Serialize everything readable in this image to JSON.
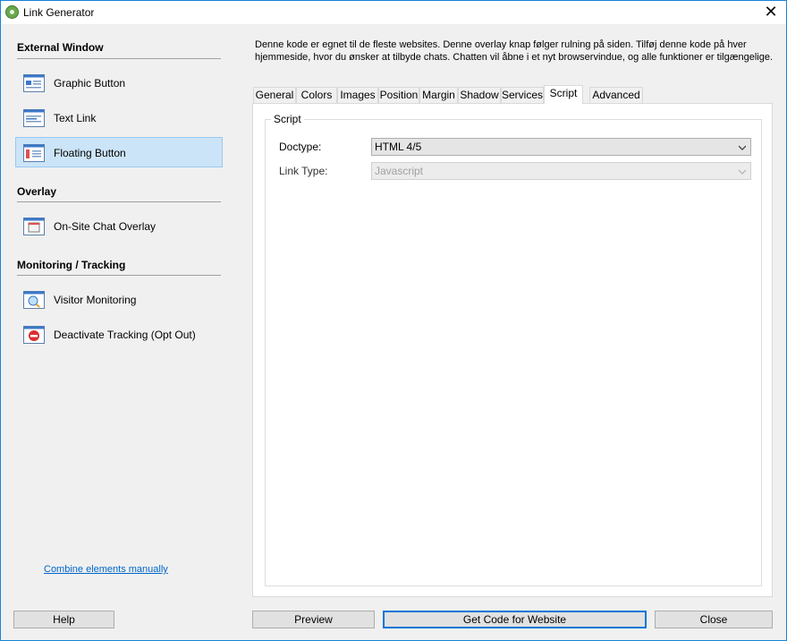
{
  "window": {
    "title": "Link Generator"
  },
  "sidebar": {
    "sections": [
      {
        "title": "External Window",
        "items": [
          {
            "label": "Graphic Button",
            "icon": "graphic-button-icon",
            "selected": false
          },
          {
            "label": "Text Link",
            "icon": "text-link-icon",
            "selected": false
          },
          {
            "label": "Floating Button",
            "icon": "floating-button-icon",
            "selected": true
          }
        ]
      },
      {
        "title": "Overlay",
        "items": [
          {
            "label": "On-Site Chat Overlay",
            "icon": "chat-overlay-icon",
            "selected": false
          }
        ]
      },
      {
        "title": "Monitoring / Tracking",
        "items": [
          {
            "label": "Visitor Monitoring",
            "icon": "visitor-monitoring-icon",
            "selected": false
          },
          {
            "label": "Deactivate Tracking (Opt Out)",
            "icon": "deactivate-tracking-icon",
            "selected": false
          }
        ]
      }
    ],
    "combine_link": "Combine elements manually"
  },
  "main": {
    "description": "Denne kode er egnet til de fleste websites. Denne overlay knap følger rulning på siden. Tilføj denne kode på hver hjemmeside, hvor du ønsker at tilbyde chats. Chatten vil åbne i et nyt browservindue, og alle funktioner er tilgængelige.",
    "tabs": [
      "General",
      "Colors",
      "Images",
      "Position",
      "Margin",
      "Shadow",
      "Services",
      "Script",
      "Advanced"
    ],
    "active_tab": "Script",
    "group_title": "Script",
    "fields": {
      "doctype": {
        "label": "Doctype:",
        "value": "HTML 4/5"
      },
      "link_type": {
        "label": "Link Type:",
        "value": "Javascript",
        "disabled": true
      }
    }
  },
  "footer": {
    "help": "Help",
    "preview": "Preview",
    "get_code": "Get Code for Website",
    "close": "Close"
  },
  "colors": {
    "accent": "#0078d7",
    "selection": "#cce4f7",
    "link": "#0066cc"
  }
}
